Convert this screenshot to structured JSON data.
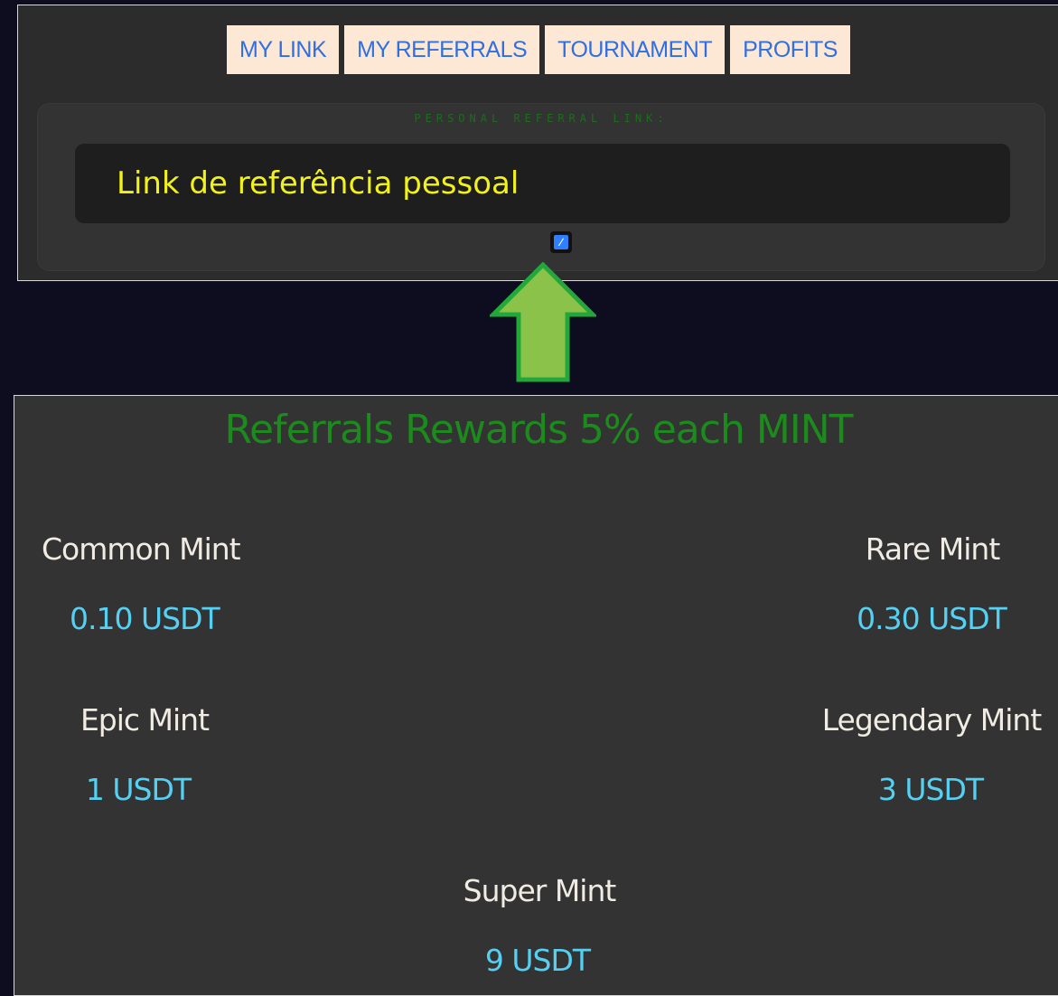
{
  "tabs": [
    {
      "label": "MY LINK"
    },
    {
      "label": "MY REFERRALS"
    },
    {
      "label": "TOURNAMENT"
    },
    {
      "label": "PROFITS"
    }
  ],
  "referral": {
    "heading": "PERSONAL REFERRAL LINK:",
    "link_text": "Link de referência pessoal",
    "copy_icon": "link-icon"
  },
  "arrow_icon": "up-arrow-icon",
  "rewards": {
    "title": "Referrals Rewards 5% each MINT",
    "tiers": [
      {
        "name": "Common Mint",
        "value": "0.10 USDT"
      },
      {
        "name": "Rare Mint",
        "value": "0.30 USDT"
      },
      {
        "name": "Epic Mint",
        "value": "1 USDT"
      },
      {
        "name": "Legendary Mint",
        "value": "3 USDT"
      },
      {
        "name": "Super Mint",
        "value": "9 USDT"
      }
    ]
  },
  "colors": {
    "background": "#0d0d1f",
    "panel": "#333333",
    "tab_bg": "#fde8d6",
    "tab_text": "#2f6fe0",
    "link_text": "#f2f21a",
    "title_green": "#1c8a1c",
    "value_cyan": "#55d0f2",
    "arrow_fill": "#8bc34a",
    "arrow_stroke": "#22a83a"
  }
}
